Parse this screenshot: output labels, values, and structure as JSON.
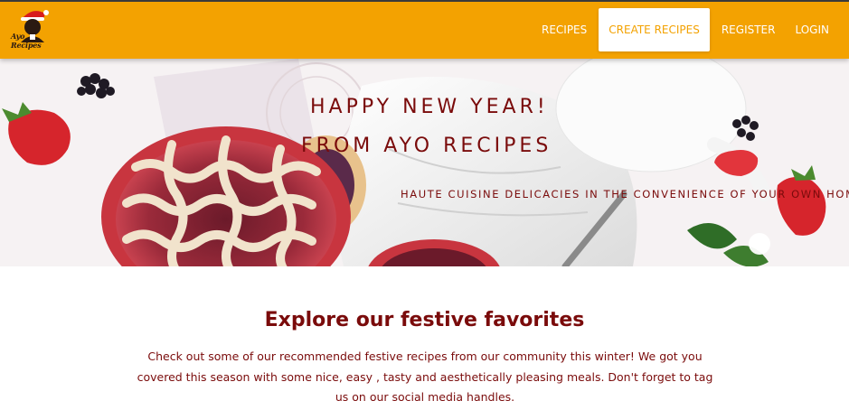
{
  "nav": {
    "logo_text": "Ayo Recipes",
    "links": [
      {
        "label": "RECIPES",
        "active": false
      },
      {
        "label": "CREATE RECIPES",
        "active": true
      },
      {
        "label": "REGISTER",
        "active": false
      },
      {
        "label": "LOGIN",
        "active": false
      }
    ]
  },
  "hero": {
    "line1": "HAPPY NEW YEAR!",
    "line2": "FROM AYO RECIPES",
    "tagline": "HAUTE CUISINE DELICACIES IN THE CONVENIENCE OF YOUR OWN HOME."
  },
  "content": {
    "title": "Explore our festive favorites",
    "body": "Check out some of our recommended festive recipes from our community this winter! We got you covered this season with some nice, easy , tasty and aesthetically pleasing meals. Don't forget to tag us on our social media handles."
  },
  "colors": {
    "navbar": "#f3a201",
    "accent_text": "#7a0b0b",
    "active_tab_bg": "#ffffff"
  }
}
